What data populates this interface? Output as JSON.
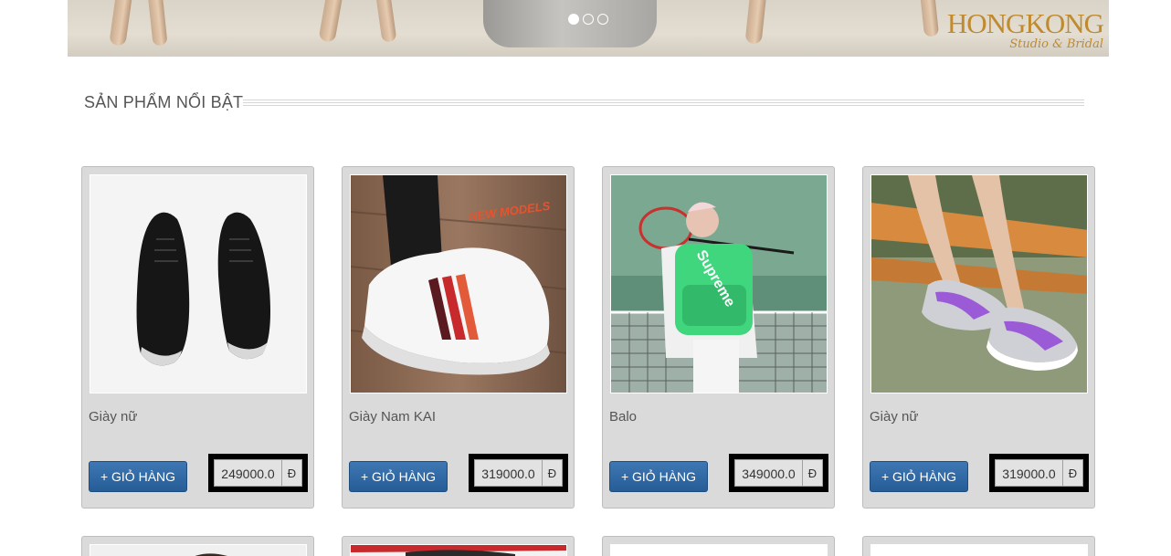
{
  "banner": {
    "logo_main": "HONGKONG",
    "logo_sub": "Studio & Bridal",
    "slides": [
      {
        "label": "slide 1",
        "active": true
      },
      {
        "label": "slide 2",
        "active": false
      },
      {
        "label": "slide 3",
        "active": false
      }
    ]
  },
  "section": {
    "title": "SẢN PHẨM NỔI BẬT"
  },
  "products": [
    {
      "name": "Giày nữ",
      "cart_label": "+ GIỎ HÀNG",
      "price": "249000.0",
      "currency": "Đ",
      "image": "black-sneakers"
    },
    {
      "name": "Giày Nam KAI",
      "cart_label": "+ GIỎ HÀNG",
      "price": "319000.0",
      "currency": "Đ",
      "image": "white-sneaker-new-models",
      "image_text": "NEW MODELS"
    },
    {
      "name": "Balo",
      "cart_label": "+ GIỎ HÀNG",
      "price": "349000.0",
      "currency": "Đ",
      "image": "green-backpack-tennis"
    },
    {
      "name": "Giày nữ",
      "cart_label": "+ GIỎ HÀNG",
      "price": "319000.0",
      "currency": "Đ",
      "image": "purple-running-shoes"
    }
  ],
  "colors": {
    "cart_button": "#2f67a3",
    "card_bg": "#dadada",
    "logo_gold": "#c08a2e"
  }
}
